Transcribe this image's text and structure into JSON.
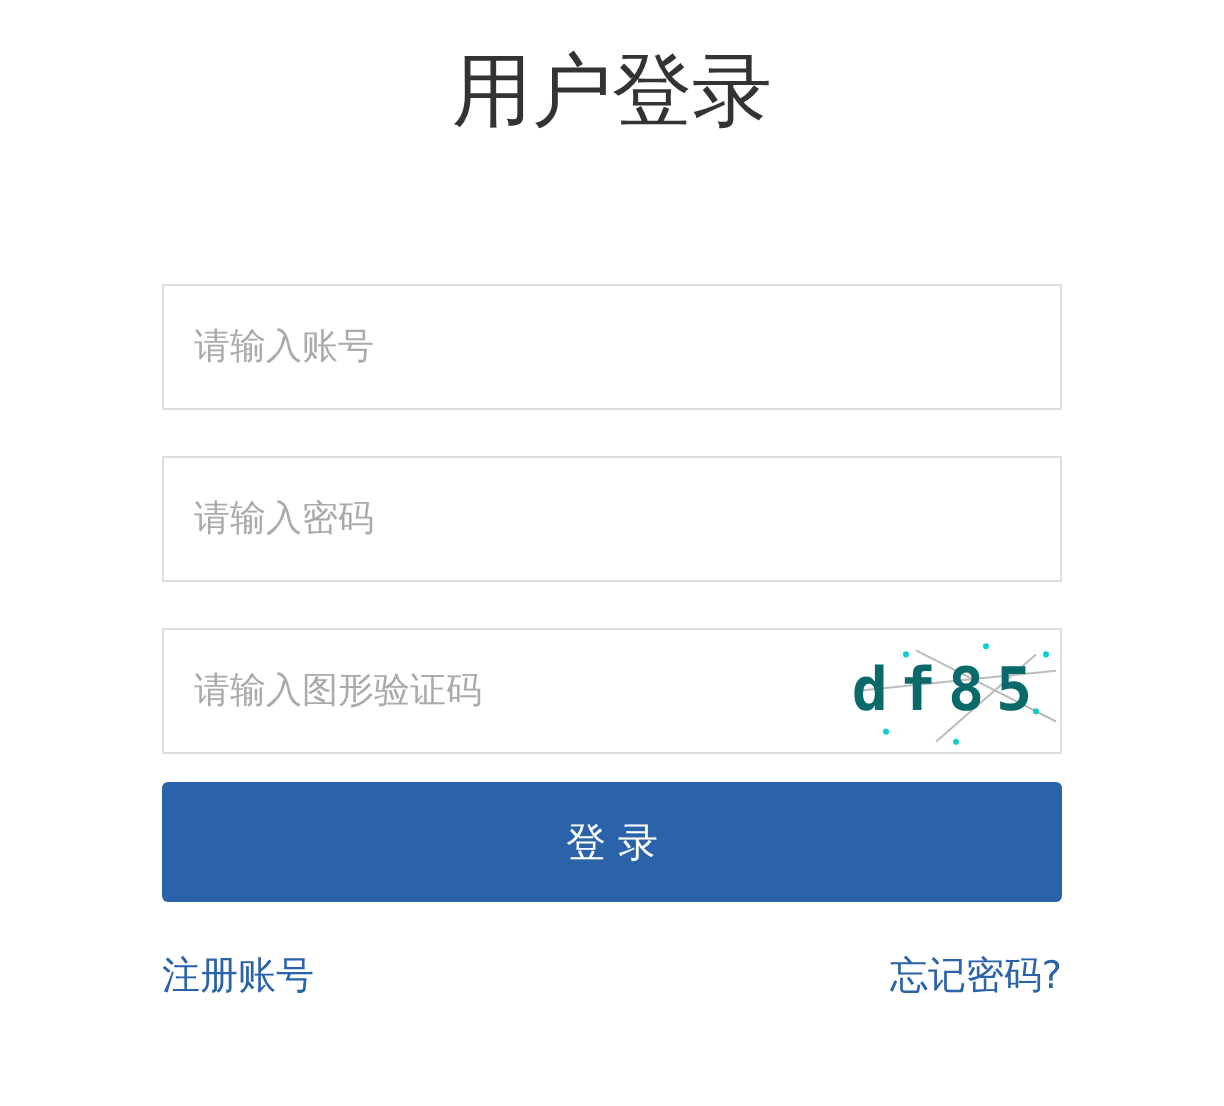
{
  "title": "用户登录",
  "fields": [
    {
      "placeholder": "请输入账号",
      "kind": "text"
    },
    {
      "placeholder": "请输入密码",
      "kind": "password"
    },
    {
      "placeholder": "请输入图形验证码",
      "kind": "captcha"
    }
  ],
  "captcha": "df85",
  "login_button": "登 录",
  "links": [
    "注册账号",
    "忘记密码?"
  ]
}
